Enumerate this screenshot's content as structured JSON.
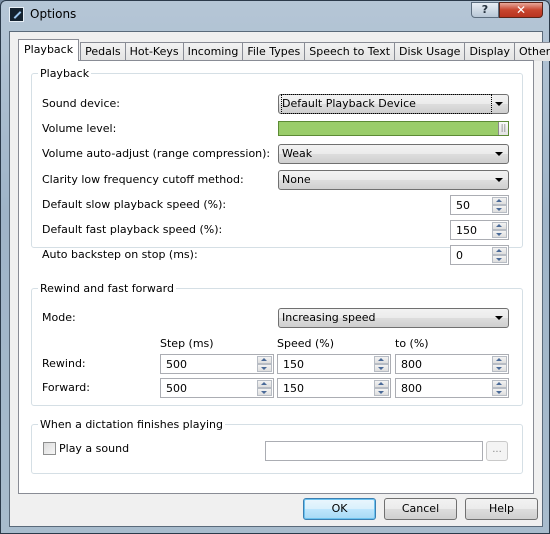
{
  "window": {
    "title": "Options",
    "help_button": "?",
    "close_button": "✕"
  },
  "tabs": [
    {
      "label": "Playback",
      "active": true
    },
    {
      "label": "Pedals",
      "active": false
    },
    {
      "label": "Hot-Keys",
      "active": false
    },
    {
      "label": "Incoming",
      "active": false
    },
    {
      "label": "File Types",
      "active": false
    },
    {
      "label": "Speech to Text",
      "active": false
    },
    {
      "label": "Disk Usage",
      "active": false
    },
    {
      "label": "Display",
      "active": false
    },
    {
      "label": "Other",
      "active": false
    }
  ],
  "playback": {
    "group_title": "Playback",
    "sound_device": {
      "label": "Sound device:",
      "value": "Default Playback Device"
    },
    "volume_level": {
      "label": "Volume level:",
      "value_percent": 100,
      "fill_color": "#9acd6a"
    },
    "auto_adjust": {
      "label": "Volume auto-adjust (range compression):",
      "value": "Weak"
    },
    "clarity": {
      "label": "Clarity low frequency cutoff method:",
      "value": "None"
    },
    "slow_speed": {
      "label": "Default slow playback speed (%):",
      "value": "50"
    },
    "fast_speed": {
      "label": "Default fast playback speed (%):",
      "value": "150"
    },
    "backstep": {
      "label": "Auto backstep on stop (ms):",
      "value": "0"
    }
  },
  "rewind_ff": {
    "group_title": "Rewind and fast forward",
    "mode": {
      "label": "Mode:",
      "value": "Increasing speed"
    },
    "columns": {
      "step": "Step (ms)",
      "speed": "Speed (%)",
      "to": "to (%)"
    },
    "rewind": {
      "label": "Rewind:",
      "step": "500",
      "speed": "150",
      "to": "800"
    },
    "forward": {
      "label": "Forward:",
      "step": "500",
      "speed": "150",
      "to": "800"
    }
  },
  "finish": {
    "group_title": "When a dictation finishes playing",
    "play_sound_label": "Play a sound",
    "play_sound_checked": false,
    "sound_file": "",
    "browse_label": "..."
  },
  "buttons": {
    "ok": "OK",
    "cancel": "Cancel",
    "help": "Help"
  }
}
